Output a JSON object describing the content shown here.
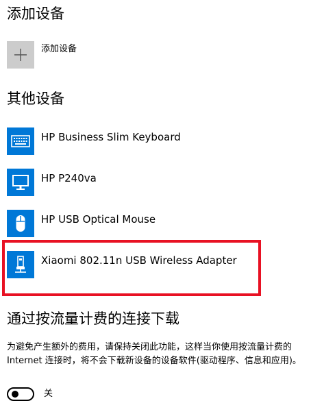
{
  "add_section": {
    "title": "添加设备",
    "add_label": "添加设备",
    "icon": "plus-icon"
  },
  "other_section": {
    "title": "其他设备",
    "devices": [
      {
        "name": "HP Business Slim Keyboard",
        "icon": "keyboard-icon"
      },
      {
        "name": "HP P240va",
        "icon": "monitor-icon"
      },
      {
        "name": "HP USB Optical Mouse",
        "icon": "mouse-icon"
      },
      {
        "name": "Xiaomi 802.11n USB Wireless Adapter",
        "icon": "usb-adapter-icon"
      }
    ]
  },
  "metered_section": {
    "title": "通过按流量计费的连接下载",
    "description": "为避免产生额外的费用，请保持关闭此功能，这样当你使用按流量计费的 Internet 连接时，将不会下载新设备的设备软件(驱动程序、信息和应用)。",
    "toggle_state": "关"
  },
  "colors": {
    "accent": "#0078d7",
    "add_tile": "#cccccc",
    "highlight": "#e81123"
  }
}
